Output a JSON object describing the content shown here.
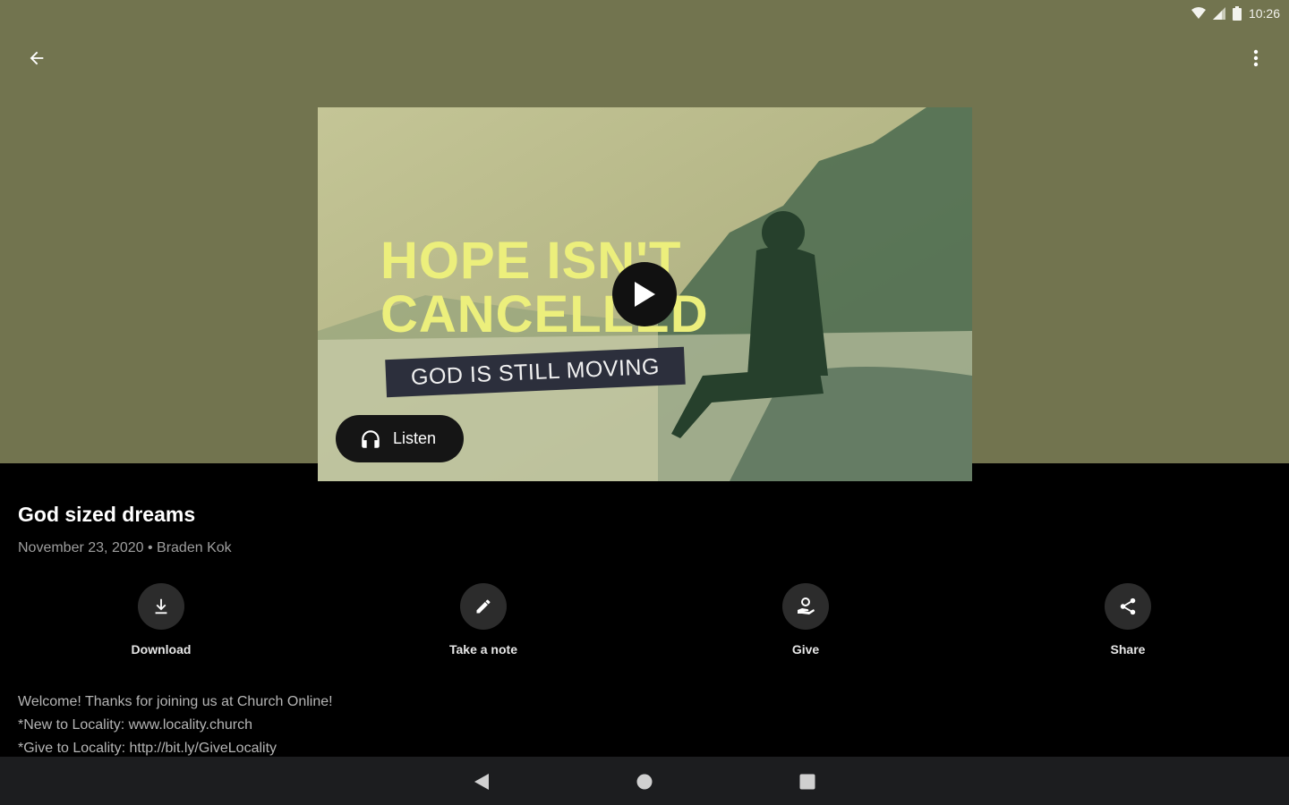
{
  "status_bar": {
    "time": "10:26",
    "wifi_icon": "wifi-icon",
    "signal_icon": "signal-icon",
    "battery_icon": "battery-icon"
  },
  "header": {
    "back_icon": "arrow-back-icon",
    "menu_icon": "more-vert-icon"
  },
  "thumbnail": {
    "title_text": "HOPE ISN'T\nCANCELLED",
    "banner_text": "GOD IS STILL MOVING",
    "play_icon": "play-icon",
    "listen_label": "Listen",
    "listen_icon": "headphones-icon"
  },
  "colors": {
    "hero_bg": "#72744f",
    "title_yellow": "#ecef7c",
    "banner_bg": "#2c2f3c"
  },
  "sermon": {
    "title": "God sized dreams",
    "meta": "November 23, 2020 • Braden Kok"
  },
  "actions": [
    {
      "label": "Download",
      "icon": "download-icon"
    },
    {
      "label": "Take a note",
      "icon": "pencil-icon"
    },
    {
      "label": "Give",
      "icon": "give-icon"
    },
    {
      "label": "Share",
      "icon": "share-icon"
    }
  ],
  "description": [
    "Welcome! Thanks for joining us at Church Online!",
    "*New to Locality: www.locality.church",
    "*Give to Locality: http://bit.ly/GiveLocality"
  ],
  "nav": {
    "back_icon": "nav-back-icon",
    "home_icon": "nav-home-icon",
    "recents_icon": "nav-recents-icon"
  }
}
